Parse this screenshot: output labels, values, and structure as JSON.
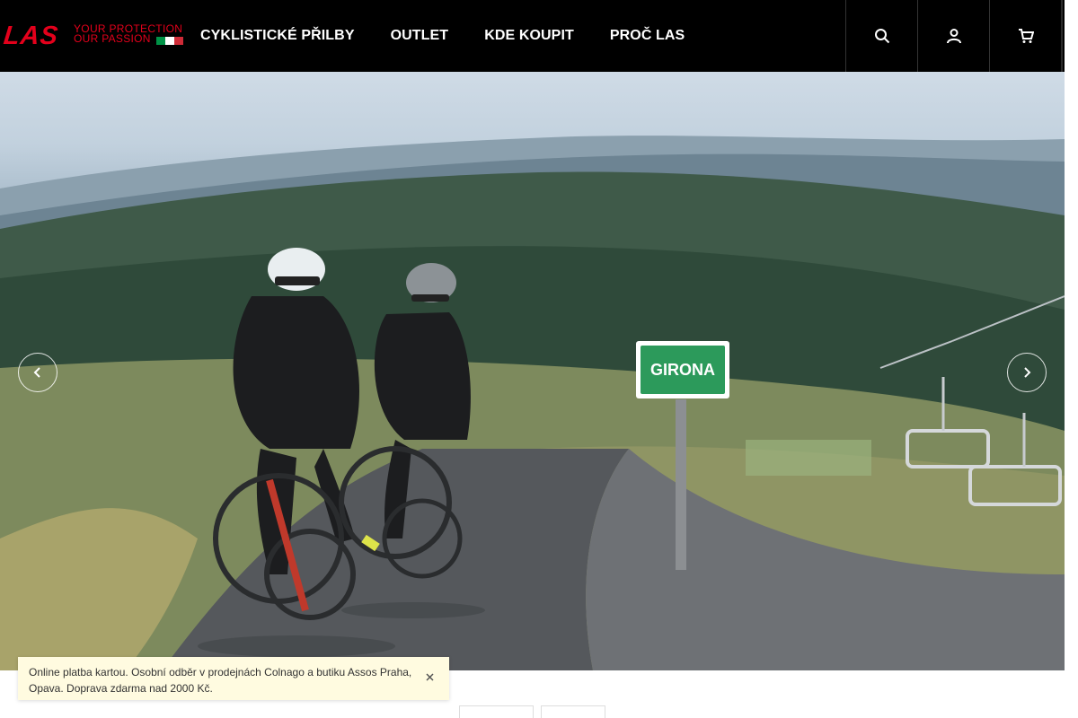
{
  "brand": {
    "logo_text": "LAS",
    "tagline_line1": "YOUR PROTECTION",
    "tagline_line2": "OUR PASSION",
    "brand_color": "#e3001b",
    "flag_colors": [
      "#009246",
      "#ffffff",
      "#ce2b37"
    ]
  },
  "nav": {
    "items": [
      {
        "label": "CYKLISTICKÉ PŘILBY"
      },
      {
        "label": "OUTLET"
      },
      {
        "label": "KDE KOUPIT"
      },
      {
        "label": "PROČ LAS"
      }
    ]
  },
  "header_icons": [
    "search-icon",
    "user-icon",
    "cart-icon"
  ],
  "hero": {
    "sign_text": "GIRONA",
    "prev_icon": "chevron-left-icon",
    "next_icon": "chevron-right-icon"
  },
  "notice": {
    "text": "Online platba kartou. Osobní odběr v prodejnách Colnago a butiku Assos Praha, Opava. Doprava zdarma nad 2000 Kč.",
    "close_icon": "close-icon"
  },
  "colors": {
    "header_bg": "#000000",
    "nav_text": "#ffffff",
    "notice_bg": "#fffbe0"
  }
}
